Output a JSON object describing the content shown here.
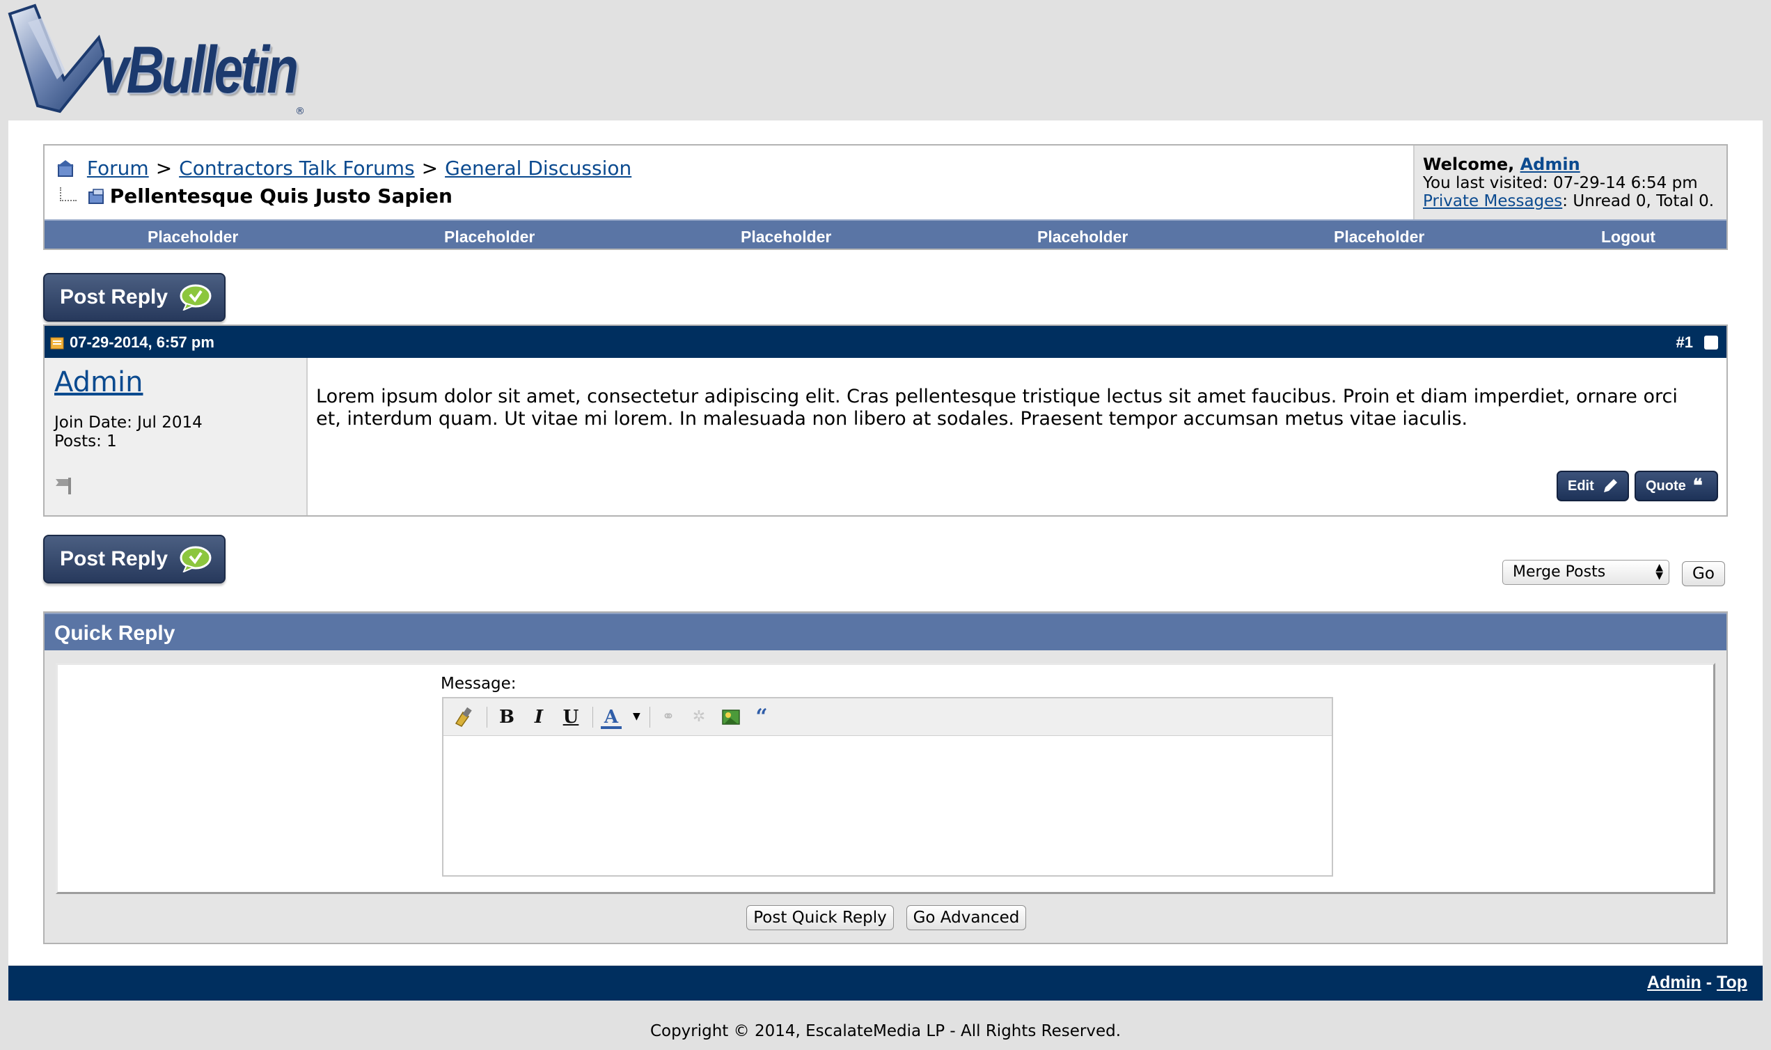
{
  "header": {
    "logo_text": "vBulletin",
    "logo_reg": "®"
  },
  "breadcrumb": {
    "items": [
      "Forum",
      "Contractors Talk Forums",
      "General Discussion"
    ],
    "separator": ">",
    "thread_title": "Pellentesque Quis Justo Sapien"
  },
  "welcome": {
    "prefix": "Welcome, ",
    "username": "Admin",
    "last_visited": "You last visited: 07-29-14 6:54 pm",
    "pm_link": "Private Messages",
    "pm_status": ": Unread 0, Total 0."
  },
  "nav": {
    "items": [
      "Placeholder",
      "Placeholder",
      "Placeholder",
      "Placeholder",
      "Placeholder",
      "Logout"
    ]
  },
  "post_reply_label": "Post Reply",
  "post": {
    "date": "07-29-2014, 6:57 pm",
    "number": "#1",
    "username": "Admin",
    "join_date": "Join Date: Jul 2014",
    "posts": "Posts: 1",
    "body": "Lorem ipsum dolor sit amet, consectetur adipiscing elit. Cras pellentesque tristique lectus sit amet faucibus. Proin et diam imperdiet, ornare orci et, interdum quam. Ut vitae mi lorem. In malesuada non libero at sodales. Praesent tempor accumsan metus vitae iaculis.",
    "edit_label": "Edit",
    "quote_label": "Quote"
  },
  "moderation": {
    "select_value": "Merge Posts",
    "go_label": "Go"
  },
  "quick_reply": {
    "title": "Quick Reply",
    "message_label": "Message:",
    "submit_label": "Post Quick Reply",
    "advanced_label": "Go Advanced",
    "toolbar": [
      "remove-format-icon",
      "bold-icon",
      "italic-icon",
      "underline-icon",
      "font-color-icon",
      "link-icon",
      "unlink-icon",
      "image-icon",
      "quote-icon"
    ]
  },
  "footer": {
    "admin_link": "Admin",
    "dash": " - ",
    "top_link": "Top",
    "copyright": "Copyright © 2014, EscalateMedia LP - All Rights Reserved."
  },
  "colors": {
    "dark_navy": "#002f5f",
    "nav_blue": "#5a75a5",
    "link": "#0b4a8f",
    "page_bg": "#e1e1e1"
  }
}
